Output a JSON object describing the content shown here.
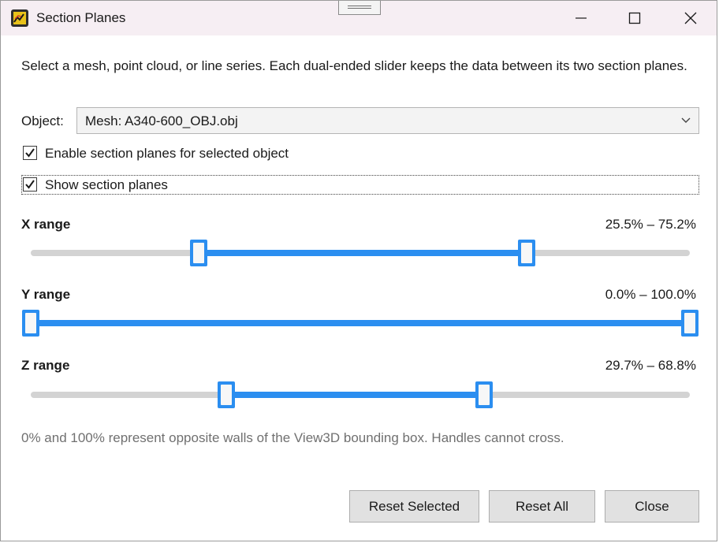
{
  "window": {
    "title": "Section Planes",
    "controls": [
      "minimize-icon",
      "maximize-icon",
      "close-icon"
    ]
  },
  "description": "Select a mesh, point cloud, or line series. Each dual-ended slider keeps the data between its two section planes.",
  "object": {
    "label": "Object:",
    "selected": "Mesh: A340-600_OBJ.obj"
  },
  "checkboxes": {
    "enable": {
      "label": "Enable section planes for selected object",
      "checked": true
    },
    "show": {
      "label": "Show section planes",
      "checked": true
    }
  },
  "ranges": [
    {
      "label": "X range",
      "value_text": "25.5% – 75.2%",
      "low": 25.5,
      "high": 75.2
    },
    {
      "label": "Y range",
      "value_text": "0.0% – 100.0%",
      "low": 0.0,
      "high": 100.0
    },
    {
      "label": "Z range",
      "value_text": "29.7% – 68.8%",
      "low": 29.7,
      "high": 68.8
    }
  ],
  "footnote": "0% and 100% represent opposite walls of the View3D bounding box. Handles cannot cross.",
  "buttons": {
    "reset_selected": "Reset Selected",
    "reset_all": "Reset All",
    "close": "Close"
  },
  "colors": {
    "accent": "#2b8ef0",
    "track": "#d3d3d3",
    "titlebar": "#f6eef3"
  }
}
